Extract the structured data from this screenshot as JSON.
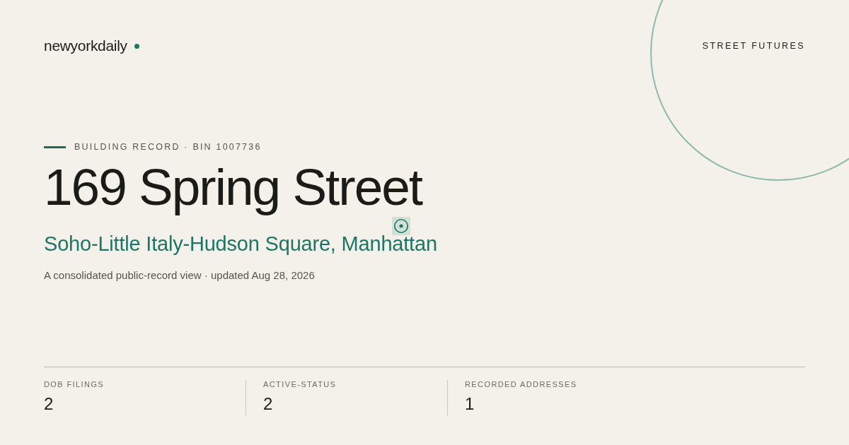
{
  "brand": {
    "name": "newyorkdaily"
  },
  "section": "STREET FUTURES",
  "eyebrow": "BUILDING RECORD · BIN 1007736",
  "title": "169 Spring Street",
  "subtitle": "Soho-Little Italy-Hudson Square, Manhattan",
  "description": "A consolidated public-record view · updated Aug 28, 2026",
  "stats": [
    {
      "label": "DOB FILINGS",
      "value": "2"
    },
    {
      "label": "ACTIVE-STATUS",
      "value": "2"
    },
    {
      "label": "RECORDED ADDRESSES",
      "value": "1"
    }
  ]
}
